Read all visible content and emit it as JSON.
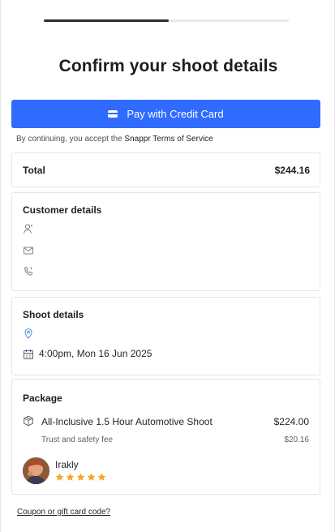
{
  "progress": {
    "fraction": 0.51
  },
  "page_title": "Confirm your shoot details",
  "pay_button": {
    "label": "Pay with Credit Card",
    "icon": "credit-card-icon"
  },
  "terms": {
    "prefix": "By continuing, you accept the ",
    "link": "Snappr Terms of Service"
  },
  "total": {
    "label": "Total",
    "value": "$244.16"
  },
  "customer": {
    "heading": "Customer details",
    "icons": [
      "user-icon",
      "mail-icon",
      "phone-icon"
    ]
  },
  "shoot": {
    "heading": "Shoot details",
    "location_icon": "location-pin-icon",
    "datetime_icon": "calendar-icon",
    "datetime": "4:00pm, Mon 16 Jun 2025"
  },
  "package": {
    "heading": "Package",
    "icon": "package-box-icon",
    "name": "All-Inclusive 1.5 Hour Automotive Shoot",
    "price": "$224.00",
    "fee_label": "Trust and safety fee",
    "fee_price": "$20.16"
  },
  "photographer": {
    "name": "Irakly",
    "rating": 5
  },
  "coupon_link": "Coupon or gift card code?",
  "colors": {
    "primary": "#2f6bff",
    "star": "#f6a623",
    "icon": "#7a8189",
    "pin": "#4a90e2"
  }
}
